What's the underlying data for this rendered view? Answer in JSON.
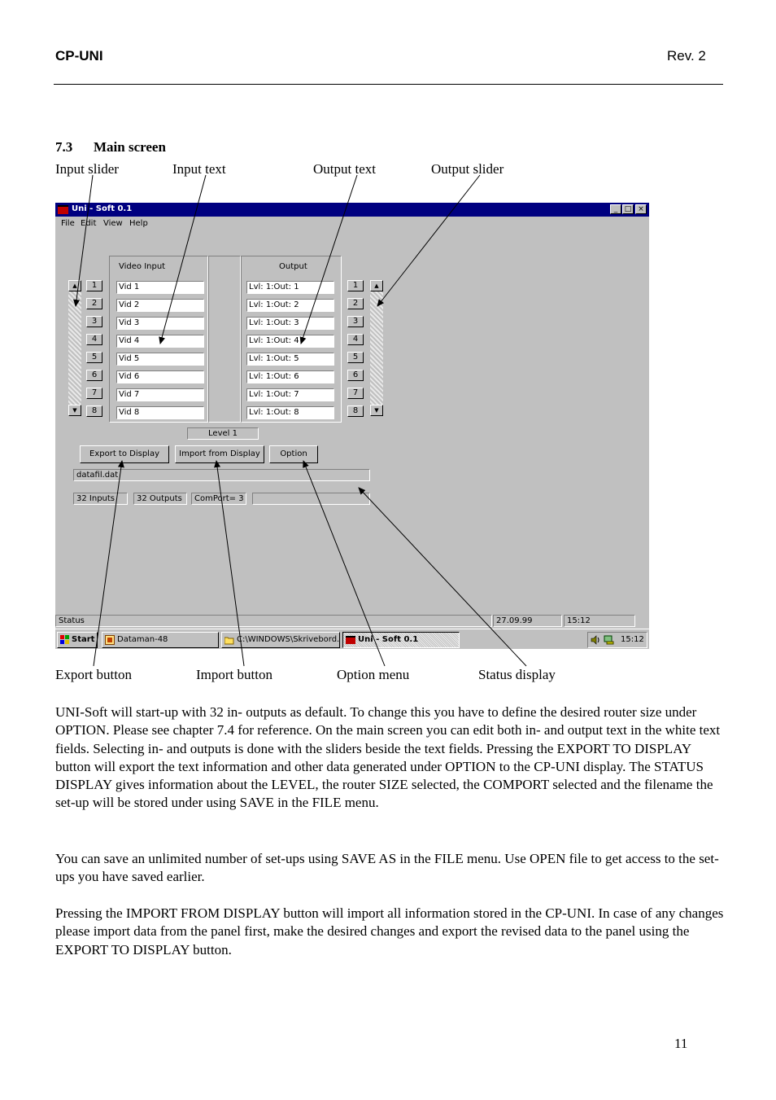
{
  "header": {
    "left": "CP-UNI",
    "right": "Rev. 2"
  },
  "section": {
    "number": "7.3",
    "title": "Main screen"
  },
  "callouts_top": [
    "Input slider",
    "Input text",
    "Output text",
    "Output slider"
  ],
  "callouts_bottom": [
    "Export button",
    "Import button",
    "Option menu",
    "Status display"
  ],
  "app": {
    "title": "Uni - Soft  0.1",
    "menu": [
      "File",
      "Edit",
      "View",
      "Help"
    ],
    "window_buttons": [
      "minimize",
      "restore",
      "close"
    ],
    "video_input_label": "Video Input",
    "output_label": "Output",
    "row_numbers": [
      "1",
      "2",
      "3",
      "4",
      "5",
      "6",
      "7",
      "8"
    ],
    "inputs": [
      "Vid 1",
      "Vid 2",
      "Vid 3",
      "Vid 4",
      "Vid 5",
      "Vid 6",
      "Vid 7",
      "Vid 8"
    ],
    "outputs": [
      "Lvl: 1:Out: 1",
      "Lvl: 1:Out: 2",
      "Lvl: 1:Out: 3",
      "Lvl: 1:Out: 4",
      "Lvl: 1:Out: 5",
      "Lvl: 1:Out: 6",
      "Lvl: 1:Out: 7",
      "Lvl: 1:Out: 8"
    ],
    "level": "Level  1",
    "buttons": {
      "export": "Export to Display",
      "import": "Import from Display",
      "option": "Option"
    },
    "filename": "datafil.dat",
    "status_fields": [
      "32 Inputs",
      "32 Outputs",
      "ComPort=  3",
      ""
    ],
    "statusbar": {
      "label": "Status",
      "date": "27.09.99",
      "time": "15:12"
    },
    "taskbar": {
      "start": "Start",
      "tasks": [
        "Dataman-48",
        "C:\\WINDOWS\\Skrivebord...",
        "Uni - Soft  0.1"
      ],
      "clock": "15:12"
    }
  },
  "paragraphs": [
    "UNI-Soft will start-up with 32 in- outputs as default. To change this you have to define the desired router size under OPTION. Please see chapter 7.4 for reference. On the main screen you can edit both in- and output text in the white text fields. Selecting in- and outputs is done with the sliders beside the text fields. Pressing the EXPORT TO DISPLAY button will export the text information and other data generated under OPTION to the CP-UNI display. The STATUS DISPLAY gives information about the LEVEL, the router SIZE selected, the COMPORT selected and the filename the set-up will be stored under using SAVE in the FILE menu.",
    "You can save an unlimited number of set-ups using SAVE AS in the FILE menu. Use OPEN file to get access to the set-ups you have saved earlier.",
    "Pressing the IMPORT FROM DISPLAY button will import all information stored in the CP-UNI. In case of any changes please import data from the panel first, make the desired changes and export the revised data to the panel using the EXPORT TO DISPLAY button."
  ],
  "page_number": "11"
}
